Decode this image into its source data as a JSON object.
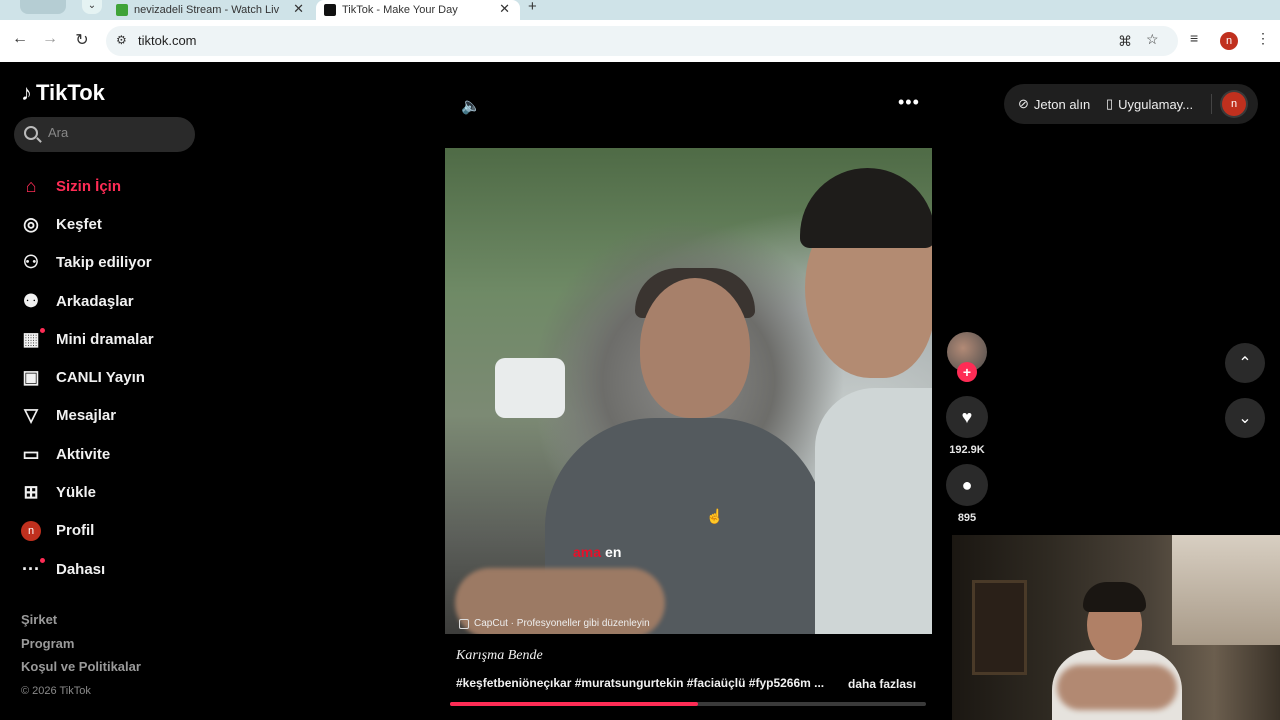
{
  "browser": {
    "tabs": [
      {
        "title": "nevizadeli Stream - Watch Liv"
      },
      {
        "title": "TikTok - Make Your Day"
      }
    ],
    "tab_close": "✕",
    "new_tab": "+",
    "url": "tiktok.com"
  },
  "brand": {
    "name": "TikTok"
  },
  "search": {
    "placeholder": "Ara"
  },
  "sidebar": {
    "items": [
      {
        "label": "Sizin İçin"
      },
      {
        "label": "Keşfet"
      },
      {
        "label": "Takip ediliyor"
      },
      {
        "label": "Arkadaşlar"
      },
      {
        "label": "Mini dramalar"
      },
      {
        "label": "CANLI Yayın"
      },
      {
        "label": "Mesajlar"
      },
      {
        "label": "Aktivite"
      },
      {
        "label": "Yükle"
      },
      {
        "label": "Profil"
      },
      {
        "label": "Dahası"
      }
    ],
    "profile_initial": "n",
    "footer": [
      "Şirket",
      "Program",
      "Koşul ve Politikalar"
    ],
    "copyright": "© 2026 TikTok"
  },
  "topbar": {
    "coins_label": "Jeton alın",
    "app_label": "Uygulamay...",
    "avatar_initial": "n"
  },
  "video": {
    "subtitle_red": "ama",
    "subtitle_white": "en",
    "capcut_label": "CapCut · Profesyoneller gibi düzenleyin",
    "title": "Karışma Bende",
    "hashtags": "#keşfetbeniöneçıkar #muratsungurtekin #faciaüçlü #fyp5266m ...",
    "more_label": "daha fazlası",
    "progress_fraction": 0.52
  },
  "actions": {
    "likes": "192.9K",
    "comments": "895"
  },
  "colors": {
    "accent": "#fe2c55",
    "background": "#000000",
    "avatar": "#c0301e"
  }
}
